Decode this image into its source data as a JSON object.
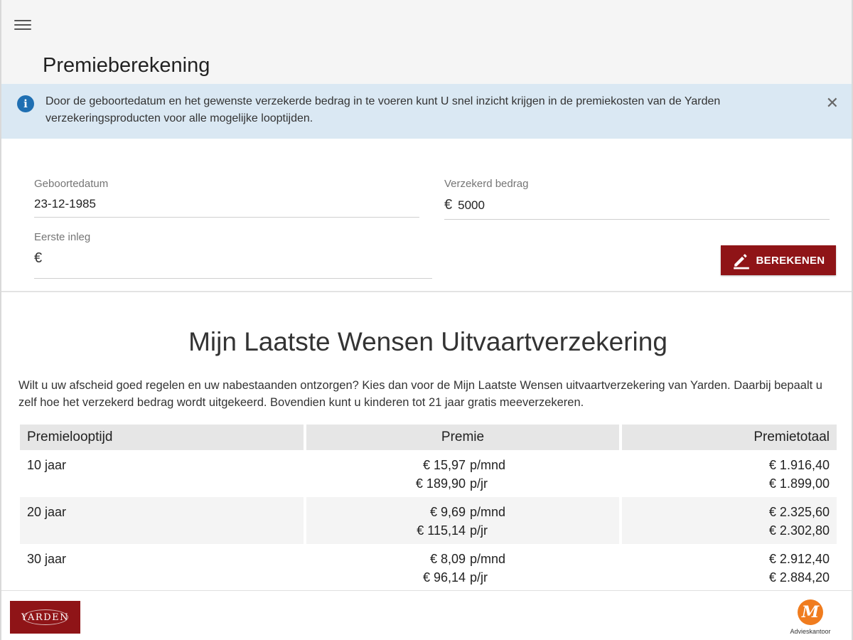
{
  "header": {
    "title": "Premieberekening",
    "menu_icon": "hamburger-menu-icon"
  },
  "info_banner": {
    "icon": "info-icon",
    "text": "Door de geboortedatum en het gewenste verzekerde bedrag in te voeren kunt U snel inzicht krijgen in de premiekosten van de Yarden verzekeringsproducten voor alle mogelijke looptijden.",
    "close_icon": "close-icon"
  },
  "form": {
    "birthdate": {
      "label": "Geboortedatum",
      "value": "23-12-1985"
    },
    "insured_amount": {
      "label": "Verzekerd bedrag",
      "prefix": "€",
      "value": "5000"
    },
    "first_deposit": {
      "label": "Eerste inleg",
      "prefix": "€",
      "value": ""
    },
    "calculate_button": {
      "label": "BEREKENEN",
      "icon": "edit-pencil-icon"
    }
  },
  "product": {
    "title": "Mijn Laatste Wensen Uitvaartverzekering",
    "description": "Wilt u uw afscheid goed regelen en uw nabestaanden ontzorgen? Kies dan voor de Mijn Laatste Wensen uitvaartverzekering van Yarden. Daarbij bepaalt u zelf hoe het verzekerd bedrag wordt uitgekeerd. Bovendien kunt u kinderen tot 21 jaar gratis meeverzekeren."
  },
  "table": {
    "headers": [
      "Premielooptijd",
      "Premie",
      "Premietotaal"
    ],
    "rows": [
      {
        "term": "10 jaar",
        "monthly": "€ 15,97",
        "monthly_unit": "p/mnd",
        "yearly": "€ 189,90",
        "yearly_unit": "p/jr",
        "total_monthly": "€ 1.916,40",
        "total_yearly": "€ 1.899,00"
      },
      {
        "term": "20 jaar",
        "monthly": "€ 9,69",
        "monthly_unit": "p/mnd",
        "yearly": "€ 115,14",
        "yearly_unit": "p/jr",
        "total_monthly": "€ 2.325,60",
        "total_yearly": "€ 2.302,80"
      },
      {
        "term": "30 jaar",
        "monthly": "€ 8,09",
        "monthly_unit": "p/mnd",
        "yearly": "€ 96,14",
        "yearly_unit": "p/jr",
        "total_monthly": "€ 2.912,40",
        "total_yearly": "€ 2.884,20"
      }
    ]
  },
  "footer": {
    "brand_logo_text": "YARDEN",
    "partner_logo_letter": "M",
    "partner_label": "Advieskantoor"
  },
  "colors": {
    "brand": "#8f1417",
    "info_bg": "#dae8f3",
    "info_icon": "#1f6fb2",
    "partner_orange": "#f07c1e"
  }
}
